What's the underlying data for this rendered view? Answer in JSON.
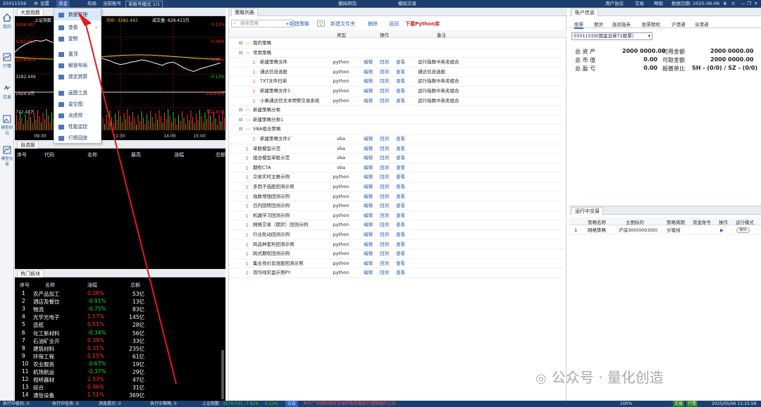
{
  "topbar": {
    "account": "55011559",
    "settings": "设置",
    "funds": "资金",
    "layout": "布局",
    "current_account": "当前账号",
    "account_mode": "单账号模式 1/1",
    "sim_research": "模拟研究",
    "sim_trade": "模拟交易",
    "user_agreement": "用户协议",
    "trade": "交易",
    "help": "帮助",
    "date_label": "数据日期: 2025-06-06"
  },
  "leftnav": {
    "items": [
      "我的",
      "行情",
      "交易",
      "模型研究",
      "模型交易"
    ]
  },
  "chart": {
    "tab": "大盘指数",
    "title": "上证指数",
    "avg_label": "均价: 3282.442",
    "volume_label": "成交量: 629.413万",
    "left_ticks": [
      "3286.487",
      "3281.651",
      "3276.855",
      "3282.449",
      "1424.9万",
      "712.43万"
    ],
    "right_ticks": [
      "0.13%",
      "0.06%",
      "0.00%",
      "-0.13%",
      "1424.9万",
      "712.43万"
    ],
    "time_ticks": [
      "09:30",
      "11:30",
      "14:00",
      "15:00"
    ],
    "colors": {
      "price": "#ffffff",
      "avg": "#f2d024",
      "up": "#ff3333",
      "down": "#2fd11f"
    }
  },
  "dropdown": {
    "items": [
      "数据管理",
      "查看",
      "复制",
      "置顶",
      "解锁布局",
      "锁定跨屏",
      "画图工具",
      "星空图",
      "龙虎榜",
      "性能监控",
      "行情回放"
    ]
  },
  "quote": {
    "tab": "自选股",
    "headers": [
      "序号",
      "代码",
      "名称",
      "最高",
      "涨幅",
      "总额"
    ]
  },
  "hot": {
    "tab": "热门板块",
    "headers": [
      "序号",
      "名称",
      "涨幅",
      "总额"
    ],
    "rows": [
      {
        "n": "1",
        "name": "农产品加工",
        "chg": "0.08%",
        "amt": "53亿"
      },
      {
        "n": "2",
        "name": "酒店及餐饮",
        "chg": "-0.91%",
        "amt": "13亿"
      },
      {
        "n": "3",
        "name": "物流",
        "chg": "-0.75%",
        "amt": "83亿"
      },
      {
        "n": "4",
        "name": "光学光电子",
        "chg": "1.57%",
        "amt": "145亿"
      },
      {
        "n": "5",
        "name": "造纸",
        "chg": "0.51%",
        "amt": "28亿"
      },
      {
        "n": "6",
        "name": "化工新材料",
        "chg": "-0.34%",
        "amt": "56亿"
      },
      {
        "n": "7",
        "name": "石油矿业开",
        "chg": "0.39%",
        "amt": "33亿"
      },
      {
        "n": "8",
        "name": "建筑材料",
        "chg": "0.31%",
        "amt": "235亿"
      },
      {
        "n": "9",
        "name": "环保工程",
        "chg": "0.15%",
        "amt": "61亿"
      },
      {
        "n": "10",
        "name": "农业服务",
        "chg": "-0.67%",
        "amt": "19亿"
      },
      {
        "n": "11",
        "name": "机场航运",
        "chg": "-0.37%",
        "amt": "29亿"
      },
      {
        "n": "12",
        "name": "视听器材",
        "chg": "2.53%",
        "amt": "47亿"
      },
      {
        "n": "13",
        "name": "综合",
        "chg": "0.46%",
        "amt": "31亿"
      },
      {
        "n": "14",
        "name": "通信设备",
        "chg": "1.51%",
        "amt": "369亿"
      }
    ]
  },
  "strategy": {
    "tab": "策略列表",
    "search_placeholder": "搜索策略",
    "toolbar": {
      "new": "+新建策略",
      "new_folder": "新建文件夹",
      "delete": "删除",
      "back": "返回",
      "download": "下载Python库"
    },
    "headers": {
      "type": "类型",
      "ops": "操作",
      "note": "备注"
    },
    "ops": [
      "编辑",
      "回测",
      "查看"
    ],
    "rows": [
      {
        "name": "我的策略",
        "type": "",
        "note": ""
      },
      {
        "name": "常用策略",
        "type": "",
        "note": ""
      },
      {
        "name": "新建策略文件",
        "type": "python",
        "note": "运行指数中英卖组合"
      },
      {
        "name": "通达信自选股",
        "type": "python",
        "note": "通达信自选股"
      },
      {
        "name": "TXT文件扫单",
        "type": "python",
        "note": "运行指数中英卖组合"
      },
      {
        "name": "新建策略文件1",
        "type": "python",
        "note": "运行指数中英卖组合"
      },
      {
        "name": "小果通达信文本预警交易系统",
        "type": "python",
        "note": "运行指数中英卖组合"
      },
      {
        "name": "新建策略分类",
        "type": "",
        "note": ""
      },
      {
        "name": "新建策略分类1",
        "type": "",
        "note": ""
      },
      {
        "name": "VBA组合策略",
        "type": "",
        "note": ""
      },
      {
        "name": "新建策略文件2",
        "type": "vba",
        "note": ""
      },
      {
        "name": "单股模型示范",
        "type": "vba",
        "note": ""
      },
      {
        "name": "组合模型单股示范",
        "type": "vba",
        "note": ""
      },
      {
        "name": "期权CTA",
        "type": "vba",
        "note": ""
      },
      {
        "name": "交易实时主推示例",
        "type": "python",
        "note": ""
      },
      {
        "name": "多因子选股回测示例",
        "type": "python",
        "note": ""
      },
      {
        "name": "指数增强回测示例",
        "type": "python",
        "note": ""
      },
      {
        "name": "日内回转回测示例",
        "type": "python",
        "note": ""
      },
      {
        "name": "机器学习回测示例",
        "type": "python",
        "note": ""
      },
      {
        "name": "网格交易（期货）回测示例",
        "type": "python",
        "note": ""
      },
      {
        "name": "行业轮动回测示例",
        "type": "python",
        "note": ""
      },
      {
        "name": "跨品种套利回测示例",
        "type": "python",
        "note": ""
      },
      {
        "name": "跨式期权回测示例",
        "type": "python",
        "note": ""
      },
      {
        "name": "集合竞价追涨股回测示例",
        "type": "python",
        "note": ""
      },
      {
        "name": "双均线实盘示例PY",
        "type": "python",
        "note": ""
      }
    ]
  },
  "account": {
    "tab": "账户信息",
    "subtabs": [
      "股票",
      "期货",
      "融资融券",
      "股票期权",
      "沪港通",
      "深港通"
    ],
    "selector": "55011559(国金证券T2股票）",
    "labels": [
      "总 资 产",
      "总 市 值",
      "总 盈 亏"
    ],
    "values": [
      "2000 0000.00",
      "0.00",
      "0.00"
    ],
    "labels2": [
      "可用金额",
      "可取金额",
      "报撤单比"
    ],
    "values2": [
      "2000 0000.00",
      "2000 0000.00",
      "SH - (0/0) / SZ - (0/0)"
    ]
  },
  "running": {
    "tab": "运行中交易",
    "headers": [
      "策略名称",
      "主图标的",
      "策略周期",
      "资金账号",
      "操作",
      "运行模式"
    ],
    "row": {
      "n": "1",
      "name": "网格策略",
      "target": "沪深300(000300)",
      "period": "分笔线",
      "mode": "模拟"
    }
  },
  "status": {
    "items": [
      "执行中委托: 0",
      "执行中任务: 0",
      "消息提示: 0",
      "执行中策略: 0",
      "上证指数",
      "3279.031",
      "-7.824",
      "-0.23%",
      "公告",
      "关于广州国际期货交易所期货期权行情数据的公告",
      "100%",
      "交易",
      "行情",
      "2025/05/06 11:15:58"
    ]
  },
  "watermark": {
    "text": "公众号 · 量化创造"
  }
}
